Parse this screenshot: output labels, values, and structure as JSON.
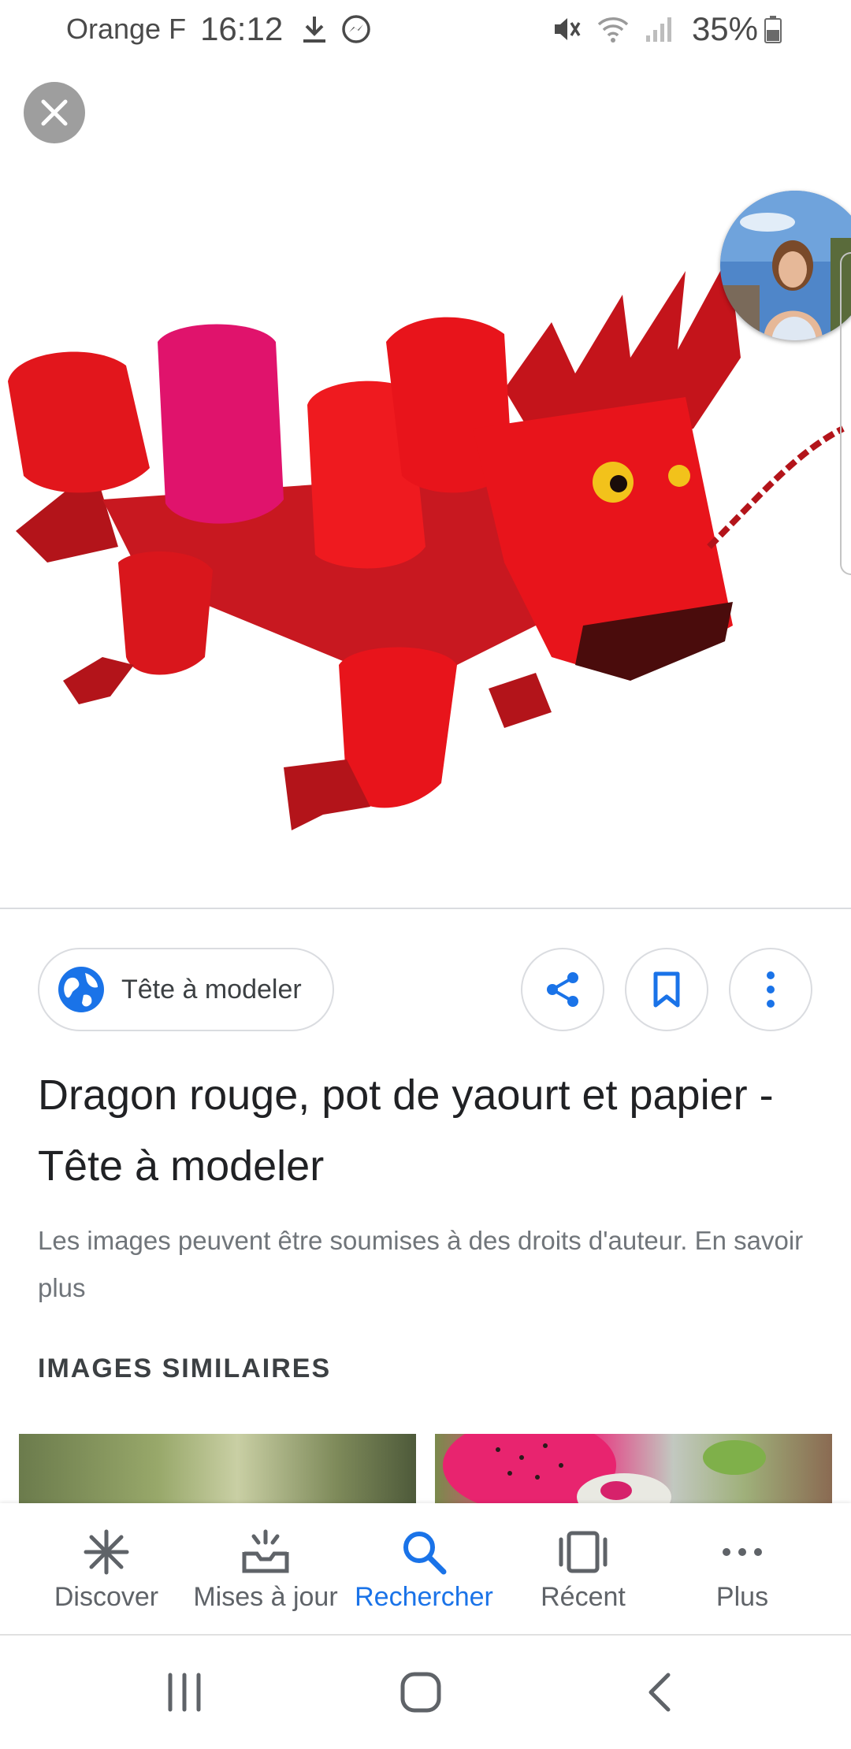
{
  "status_bar": {
    "carrier": "Orange F",
    "time": "16:12",
    "battery": "35%"
  },
  "viewer": {
    "image_subject": "red dragon made of yogurt pots"
  },
  "source": {
    "label": "Tête à modeler"
  },
  "title": "Dragon rouge, pot de yaourt et papier - Tête à modeler",
  "copyright": {
    "text": "Les images peuvent être soumises à des droits d'auteur.",
    "link": "En savoir plus"
  },
  "similar": {
    "heading": "IMAGES SIMILAIRES"
  },
  "bottom_nav": {
    "items": [
      {
        "label": "Discover",
        "icon": "asterisk-icon"
      },
      {
        "label": "Mises à jour",
        "icon": "updates-tray-icon"
      },
      {
        "label": "Rechercher",
        "icon": "search-icon"
      },
      {
        "label": "Récent",
        "icon": "recent-cards-icon"
      },
      {
        "label": "Plus",
        "icon": "more-horizontal-icon"
      }
    ],
    "active_index": 2
  },
  "colors": {
    "accent": "#1a73e8",
    "dragon_red": "#e8141b",
    "muted_text": "#70757a"
  }
}
